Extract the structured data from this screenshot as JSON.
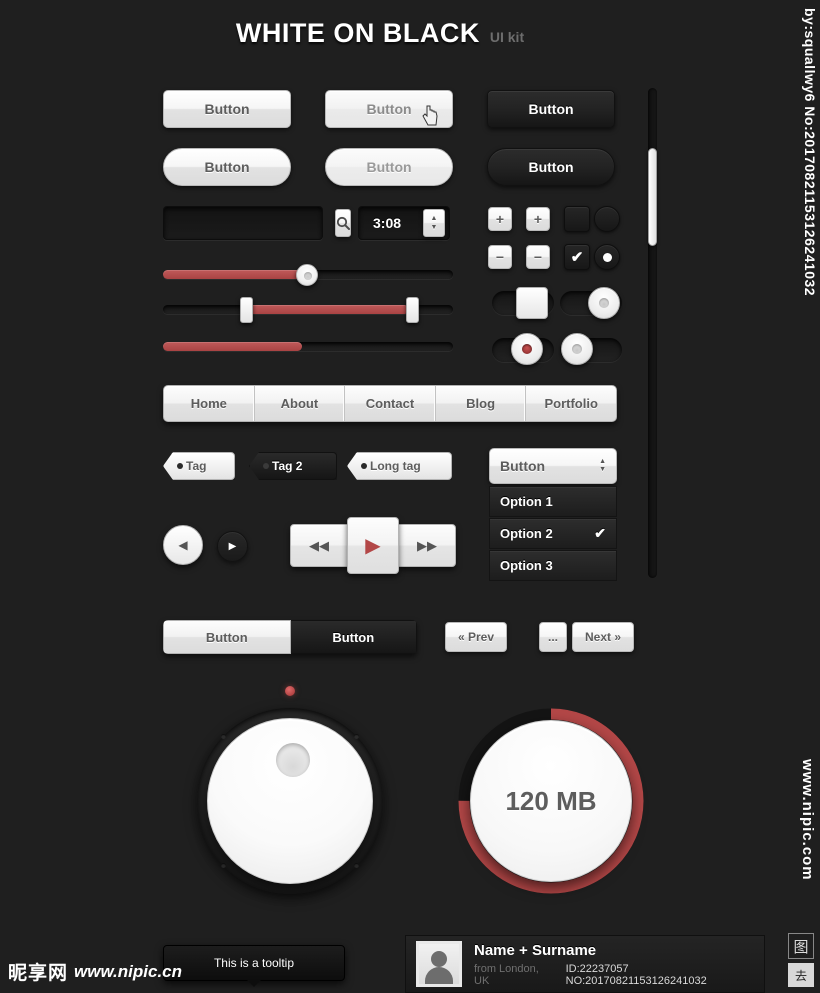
{
  "page": {
    "title_main": "WHITE ON BLACK",
    "title_sub": "UI kit",
    "background": "#1f1f1f",
    "accent": "#b34747"
  },
  "buttons": {
    "square_light": "Button",
    "square_light_hover": "Button",
    "square_dark": "Button",
    "pill_light": "Button",
    "pill_light_hover": "Button",
    "pill_dark": "Button"
  },
  "search": {
    "value": "",
    "placeholder": "",
    "icon": "search-icon"
  },
  "spinner": {
    "value": "3:08",
    "up_icon": "caret-up-icon",
    "down_icon": "caret-down-icon"
  },
  "steppers": {
    "plus_1": "+",
    "plus_2": "+",
    "minus_1": "−",
    "minus_2": "−"
  },
  "checks": {
    "checkbox_unchecked": "",
    "checkbox_checked": "✔",
    "radio_unchecked": "",
    "radio_checked": "●"
  },
  "sliders": [
    {
      "name": "single-slider",
      "fill_percent": 48,
      "handle_percent": 48,
      "handle_style": "round"
    },
    {
      "name": "range-slider",
      "start_percent": 28,
      "end_percent": 85,
      "handle_style": "bar"
    },
    {
      "name": "progress-slider",
      "fill_percent": 48,
      "handle_style": "none"
    }
  ],
  "nav": {
    "items": [
      "Home",
      "About",
      "Contact",
      "Blog",
      "Portfolio"
    ]
  },
  "tags": [
    {
      "label": "Tag",
      "style": "light"
    },
    {
      "label": "Tag 2",
      "style": "dark"
    },
    {
      "label": "Long tag",
      "style": "light"
    }
  ],
  "dropdown": {
    "label": "Button",
    "options": [
      {
        "label": "Option 1",
        "selected": false
      },
      {
        "label": "Option 2",
        "selected": true
      },
      {
        "label": "Option 3",
        "selected": false
      }
    ],
    "check_glyph": "✔"
  },
  "nav_circles": {
    "prev_icon": "◀",
    "next_icon": "▶"
  },
  "media": {
    "rewind": "◀◀",
    "play": "▶",
    "forward": "▶▶",
    "play_color": "#b34747"
  },
  "segmented": {
    "active": "Button",
    "inactive": "Button"
  },
  "pagination": {
    "prev": "« Prev",
    "ellipsis": "...",
    "next": "Next »"
  },
  "dial": {
    "name": "volume-knob",
    "led_color": "#b34747"
  },
  "gauge": {
    "value_label": "120 MB",
    "percent": 75,
    "arc_color": "#b34747"
  },
  "tooltip": {
    "text": "This is a tooltip"
  },
  "profile": {
    "name": "Name + Surname",
    "location": "from London, UK",
    "id": "ID:22237057 NO:20170821153126241032"
  },
  "toggles": [
    {
      "name": "toggle-square-on",
      "state": "on",
      "handle": "square"
    },
    {
      "name": "toggle-round-on",
      "state": "on",
      "handle": "round"
    },
    {
      "name": "toggle-round-red-off",
      "state": "off",
      "handle": "round-red"
    },
    {
      "name": "toggle-round-off",
      "state": "off",
      "handle": "round"
    }
  ],
  "scrollbar": {
    "thumb_position_percent": 12
  },
  "watermarks": {
    "right_top": "by:squallwy6 No:20170821153126241032",
    "right_bottom": "www.nipic.com",
    "bottom_left_logo": "昵享网",
    "bottom_left_url": "www.nipic.cn"
  }
}
